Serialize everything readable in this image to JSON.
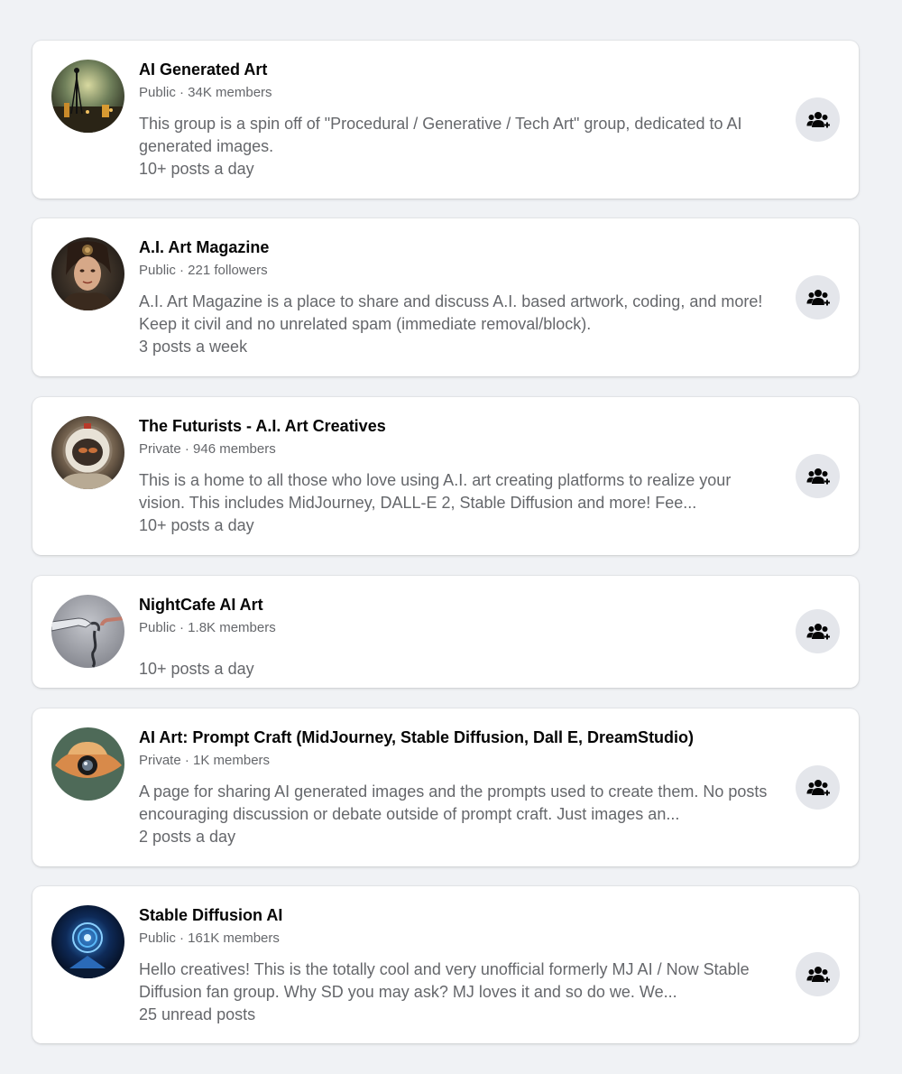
{
  "groups": [
    {
      "name": "AI Generated Art",
      "meta": "Public · 34K members",
      "description": "This group is a spin off of \"Procedural / Generative / Tech Art\" group, dedicated to AI generated images.",
      "activity": "10+ posts a day",
      "join_icon": "join-group-icon"
    },
    {
      "name": "A.I. Art Magazine",
      "meta": "Public · 221 followers",
      "description": "A.I. Art Magazine is a place to share and discuss A.I. based artwork, coding, and more! Keep it civil and no unrelated spam (immediate removal/block).",
      "activity": "3 posts a week",
      "join_icon": "join-group-icon"
    },
    {
      "name": "The Futurists - A.I. Art Creatives",
      "meta": "Private · 946 members",
      "description": "This is a home to all those who love using A.I. art creating platforms to realize your vision. This includes MidJourney, DALL-E 2, Stable Diffusion and more! Fee...",
      "activity": "10+ posts a day",
      "join_icon": "join-group-icon"
    },
    {
      "name": "NightCafe AI Art",
      "meta": "Public · 1.8K members",
      "description": "",
      "activity": "10+ posts a day",
      "join_icon": "join-group-icon"
    },
    {
      "name": "AI Art: Prompt Craft (MidJourney, Stable Diffusion, Dall E, DreamStudio)",
      "meta": "Private · 1K members",
      "description": "A page for sharing AI generated images and the prompts used to create them. No posts encouraging discussion or debate outside of prompt craft. Just images an...",
      "activity": "2 posts a day",
      "join_icon": "join-group-icon"
    },
    {
      "name": "Stable Diffusion AI",
      "meta": "Public · 161K members",
      "description": "Hello creatives! This is the totally cool and very unofficial formerly MJ AI / Now Stable Diffusion fan group. Why SD you may ask? MJ loves it and so do we. We...",
      "activity": "25 unread posts",
      "join_icon": "join-group-icon"
    }
  ],
  "colors": {
    "background": "#f0f2f5",
    "card": "#ffffff",
    "title_text": "#050505",
    "secondary_text": "#65676b",
    "button_bg": "#e4e6eb"
  }
}
